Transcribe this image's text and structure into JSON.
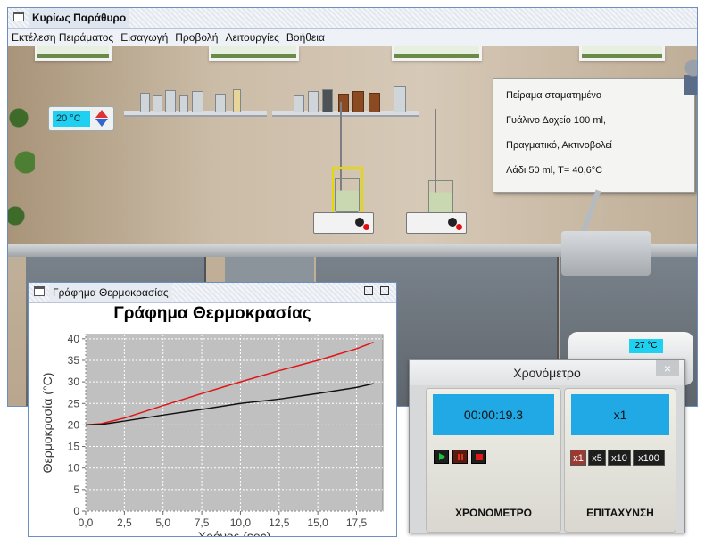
{
  "main_window": {
    "title": "Κυρίως Παράθυρο",
    "menu": [
      "Εκτέλεση Πειράματος",
      "Εισαγωγή",
      "Προβολή",
      "Λειτουργίες",
      "Βοήθεια"
    ]
  },
  "scene": {
    "room_temperature": "20 °C",
    "info_board": [
      "Πείραμα σταματημένο",
      "Γυάλινο Δοχείο 100 ml,",
      "Πραγματικό, Ακτινοβολεί",
      "Λάδι 50 ml, T= 40,6°C"
    ],
    "heater_display": "27 °C"
  },
  "graph_window": {
    "title": "Γράφημα Θερμοκρασίας"
  },
  "chart_data": {
    "type": "line",
    "title": "Γράφημα Θερμοκρασίας",
    "xlabel": "Χρόνος (sec)",
    "ylabel": "Θερμοκρασία (°C)",
    "xlim": [
      0,
      19.2
    ],
    "ylim": [
      0,
      41
    ],
    "xticks": [
      "0,0",
      "2,5",
      "5,0",
      "7,5",
      "10,0",
      "12,5",
      "15,0",
      "17,5"
    ],
    "yticks": [
      "0",
      "5",
      "10",
      "15",
      "20",
      "25",
      "30",
      "35",
      "40"
    ],
    "grid": true,
    "series": [
      {
        "color": "#e01515",
        "x": [
          0,
          1,
          2.5,
          5,
          7.5,
          10,
          12.5,
          15,
          17.5,
          18.6
        ],
        "y": [
          20,
          20.3,
          21.6,
          24.5,
          27.3,
          30,
          32.6,
          35,
          37.7,
          39.2
        ]
      },
      {
        "color": "#111111",
        "x": [
          0,
          1,
          2.5,
          5,
          7.5,
          10,
          12.5,
          15,
          17.5,
          18.6
        ],
        "y": [
          20,
          20.1,
          20.9,
          22.3,
          23.6,
          25,
          26,
          27.3,
          28.7,
          29.6
        ]
      }
    ]
  },
  "stopwatch": {
    "title": "Χρονόμετρο",
    "close": "×",
    "time": "00:00:19.3",
    "speed": "x1",
    "label_timer": "ΧΡΟΝΟΜΕΤΡΟ",
    "label_speed": "ΕΠΙΤΑΧΥΝΣΗ",
    "speed_options": [
      "x1",
      "x5",
      "x10",
      "x100"
    ]
  }
}
